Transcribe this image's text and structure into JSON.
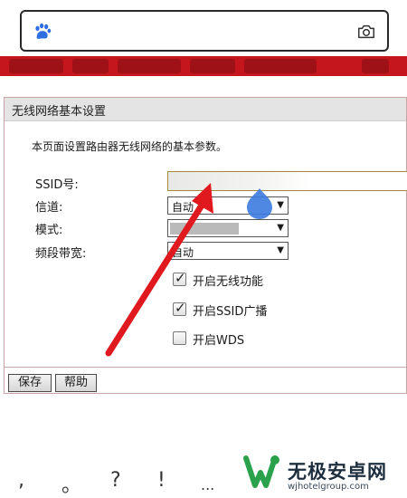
{
  "search": {
    "value": "",
    "placeholder": ""
  },
  "icons": {
    "paw": "paw-icon",
    "camera": "camera-icon"
  },
  "colors": {
    "banner": "#c4161c",
    "arrow": "#e0191f",
    "touch": "#3b7be0",
    "logo_green": "#2aa14a"
  },
  "panel": {
    "title": "无线网络基本设置",
    "description": "本页面设置路由器无线网络的基本参数。",
    "fields": {
      "ssid_label": "SSID号:",
      "ssid_value": "",
      "channel_label": "信道:",
      "channel_value": "自动",
      "mode_label": "模式:",
      "mode_value": "",
      "bandwidth_label": "频段带宽:",
      "bandwidth_value": "自动"
    },
    "checkboxes": [
      {
        "label": "开启无线功能",
        "checked": true
      },
      {
        "label": "开启SSID广播",
        "checked": true
      },
      {
        "label": "开启WDS",
        "checked": false
      }
    ],
    "buttons": {
      "save": "保存",
      "help": "帮助"
    }
  },
  "keyboard": {
    "keys": [
      ",",
      "。",
      "?",
      "!",
      "..."
    ]
  },
  "watermark": {
    "name_cn": "无极安卓网",
    "url": "wjhotelgroup.com"
  }
}
